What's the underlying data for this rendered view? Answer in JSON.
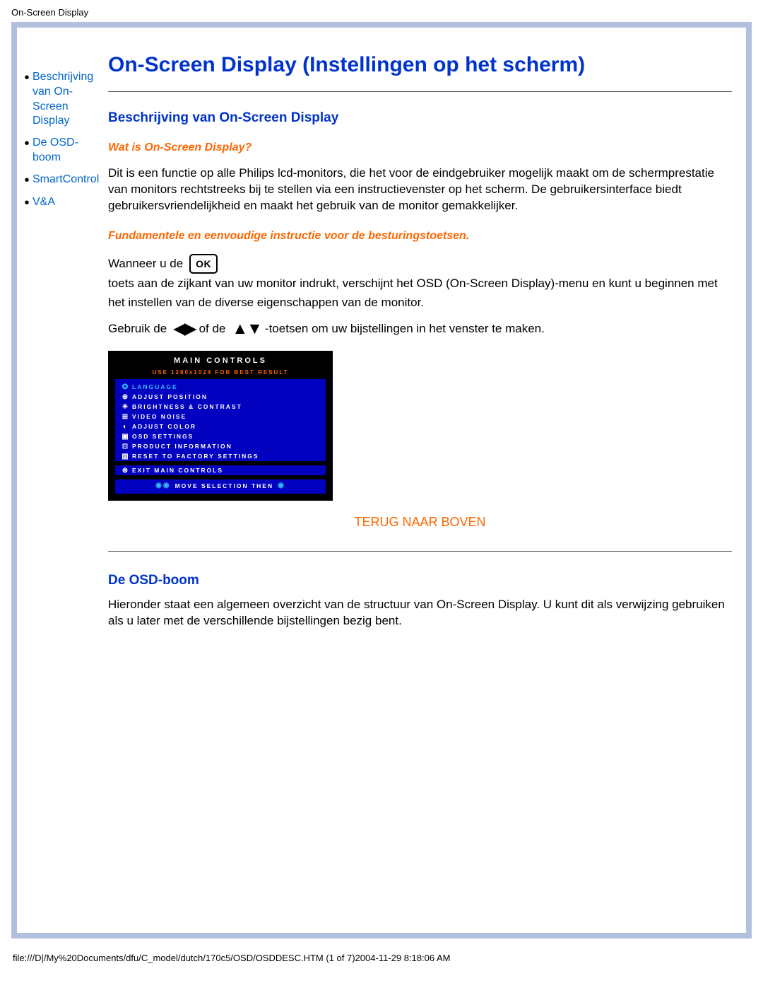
{
  "header": {
    "title": "On-Screen Display"
  },
  "sidebar": {
    "items": [
      {
        "label": "Beschrijving van On-Screen Display"
      },
      {
        "label": "De OSD-boom"
      },
      {
        "label": "SmartControl"
      },
      {
        "label": "V&A"
      }
    ]
  },
  "main": {
    "title": "On-Screen Display (Instellingen op het scherm)",
    "section1_heading": "Beschrijving van On-Screen Display",
    "sub1": "Wat is On-Screen Display?",
    "para1": "Dit is een functie op alle Philips lcd-monitors, die het voor de eindgebruiker mogelijk maakt om de schermprestatie van monitors rechtstreeks bij te stellen via een instructievenster op het scherm. De gebruikersinterface biedt gebruikersvriendelijkheid en maakt het gebruik van de monitor gemakkelijker.",
    "sub2": "Fundamentele en eenvoudige instructie voor de besturingstoetsen.",
    "inline_a": "Wanneer u de",
    "ok_label": "OK",
    "inline_b": "toets aan de zijkant van uw monitor indrukt, verschijnt het OSD (On-Screen Display)-menu en kunt u beginnen met het instellen van de diverse eigenschappen van de monitor.",
    "inline_c": "Gebruik de",
    "inline_d": "of de",
    "inline_e": "-toetsen om uw bijstellingen in het venster te maken.",
    "back_top": "TERUG NAAR BOVEN",
    "section2_heading": "De OSD-boom",
    "para2": "Hieronder staat een algemeen overzicht van de structuur van On-Screen Display. U kunt dit als verwijzing gebruiken als u later met de verschillende bijstellingen bezig bent."
  },
  "osd": {
    "title": "MAIN CONTROLS",
    "subtitle": "USE 1280x1024 FOR BEST RESULT",
    "items": [
      {
        "icon": "✪",
        "label": "LANGUAGE",
        "selected": true
      },
      {
        "icon": "⊕",
        "label": "ADJUST POSITION"
      },
      {
        "icon": "☀",
        "label": "BRIGHTNESS & CONTRAST"
      },
      {
        "icon": "⊞",
        "label": "VIDEO NOISE"
      },
      {
        "icon": "◐",
        "label": "ADJUST COLOR"
      },
      {
        "icon": "▣",
        "label": "OSD SETTINGS"
      },
      {
        "icon": "⊡",
        "label": "PRODUCT INFORMATION"
      },
      {
        "icon": "▥",
        "label": "RESET TO FACTORY SETTINGS"
      }
    ],
    "exit_icon": "⊗",
    "exit_label": "EXIT MAIN CONTROLS",
    "footer_icon_left": "◉◉",
    "footer_label": "MOVE SELECTION THEN",
    "footer_icon_right": "◉"
  },
  "footer": {
    "path": "file:///D|/My%20Documents/dfu/C_model/dutch/170c5/OSD/OSDDESC.HTM (1 of 7)2004-11-29 8:18:06 AM"
  }
}
